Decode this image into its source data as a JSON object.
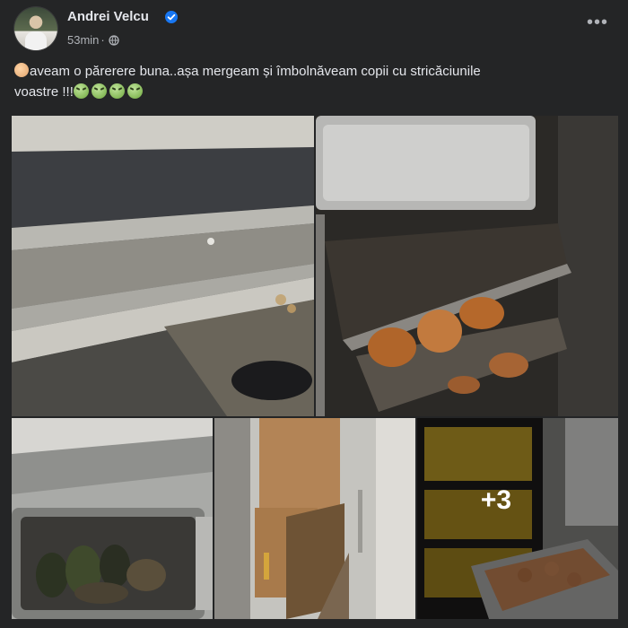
{
  "post": {
    "author": "Andrei Velcu",
    "timestamp": "53min",
    "separator": "·",
    "more_label": "•••",
    "text_line1": "aveam o părerere buna..așa mergeam și îmbolnăveam copii cu stricăciunile",
    "text_line2": "voastre !!!"
  },
  "icons": {
    "verified": "verified-badge-icon",
    "audience": "globe-icon",
    "more": "ellipsis-icon",
    "leading_emoji": "clapping-hands-emoji",
    "trailing_emoji": "sick-face-emoji"
  },
  "colors": {
    "background": "#242526",
    "text": "#e4e6eb",
    "secondary_text": "#b0b3b8",
    "verified_blue": "#1877f2"
  },
  "photos": {
    "overflow_label": "+3"
  }
}
